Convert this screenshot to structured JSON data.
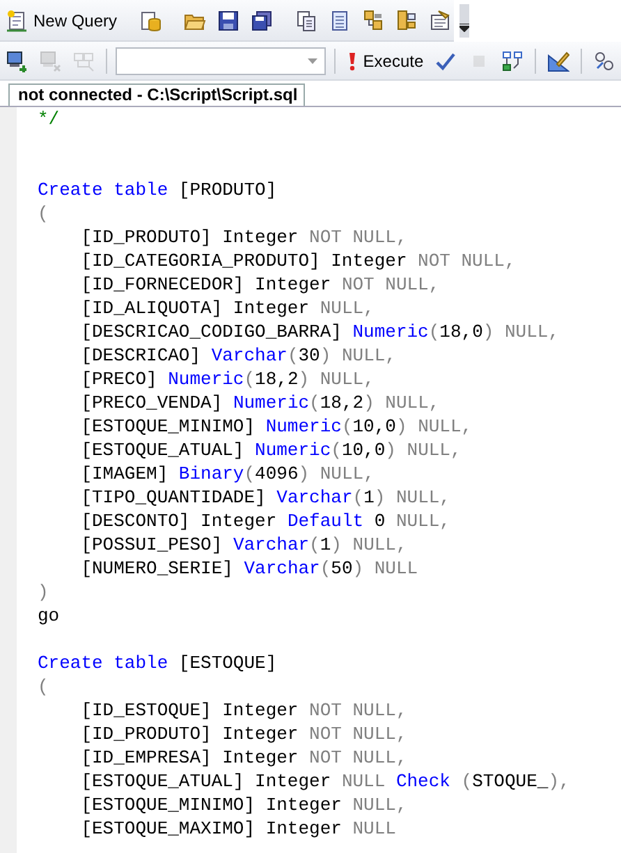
{
  "toolbars": [
    {
      "items": [
        {
          "kind": "button",
          "label": "New Query",
          "disabled": false
        },
        {
          "kind": "separator"
        },
        {
          "kind": "button",
          "disabled": false
        },
        {
          "kind": "separator"
        },
        {
          "kind": "button",
          "disabled": false
        },
        {
          "kind": "button",
          "disabled": false
        },
        {
          "kind": "button",
          "disabled": false
        },
        {
          "kind": "separator"
        },
        {
          "kind": "button",
          "disabled": false
        },
        {
          "kind": "button",
          "disabled": false
        },
        {
          "kind": "button",
          "disabled": false
        },
        {
          "kind": "button",
          "disabled": false
        },
        {
          "kind": "button",
          "disabled": false
        },
        {
          "kind": "overflow"
        }
      ]
    },
    {
      "items": [
        {
          "kind": "button",
          "disabled": false
        },
        {
          "kind": "button",
          "disabled": true
        },
        {
          "kind": "button",
          "disabled": true
        },
        {
          "kind": "separator"
        },
        {
          "kind": "dropdown"
        },
        {
          "kind": "separator"
        },
        {
          "kind": "button",
          "label": "Execute",
          "disabled": false
        },
        {
          "kind": "button",
          "disabled": false
        },
        {
          "kind": "button",
          "disabled": true
        },
        {
          "kind": "button",
          "disabled": false
        },
        {
          "kind": "separator"
        },
        {
          "kind": "button",
          "disabled": false
        },
        {
          "kind": "separator"
        },
        {
          "kind": "button",
          "disabled": false
        }
      ]
    }
  ],
  "tabs": [
    {
      "label": "not connected - C:\\Script\\Script.sql",
      "selected": true
    }
  ],
  "editor": {
    "comment_end": {
      "tokens": [
        {
          "kind": "comment",
          "text": "*/"
        }
      ]
    },
    "blocks": [
      {
        "lines": [
          {
            "tokens": [
              {
                "kind": "keyword",
                "text": "Create table"
              },
              {
                "kind": "plain",
                "text": " [PRODUTO]"
              }
            ]
          },
          {
            "tokens": [
              {
                "kind": "operator",
                "text": "("
              }
            ]
          },
          {
            "tokens": [
              {
                "kind": "plain",
                "text": "    [ID_PRODUTO] Integer "
              },
              {
                "kind": "operator",
                "text": "NOT NULL,"
              }
            ]
          },
          {
            "tokens": [
              {
                "kind": "plain",
                "text": "    [ID_CATEGORIA_PRODUTO] Integer "
              },
              {
                "kind": "operator",
                "text": "NOT NULL,"
              }
            ]
          },
          {
            "tokens": [
              {
                "kind": "plain",
                "text": "    [ID_FORNECEDOR] Integer "
              },
              {
                "kind": "operator",
                "text": "NOT NULL,"
              }
            ]
          },
          {
            "tokens": [
              {
                "kind": "plain",
                "text": "    [ID_ALIQUOTA] Integer "
              },
              {
                "kind": "operator",
                "text": "NULL,"
              }
            ]
          },
          {
            "tokens": [
              {
                "kind": "plain",
                "text": "    [DESCRICAO_CODIGO_BARRA] "
              },
              {
                "kind": "keyword",
                "text": "Numeric"
              },
              {
                "kind": "operator",
                "text": "("
              },
              {
                "kind": "plain",
                "text": "18,0"
              },
              {
                "kind": "operator",
                "text": ") NULL,"
              }
            ]
          },
          {
            "tokens": [
              {
                "kind": "plain",
                "text": "    [DESCRICAO] "
              },
              {
                "kind": "keyword",
                "text": "Varchar"
              },
              {
                "kind": "operator",
                "text": "("
              },
              {
                "kind": "plain",
                "text": "30"
              },
              {
                "kind": "operator",
                "text": ") NULL,"
              }
            ]
          },
          {
            "tokens": [
              {
                "kind": "plain",
                "text": "    [PRECO] "
              },
              {
                "kind": "keyword",
                "text": "Numeric"
              },
              {
                "kind": "operator",
                "text": "("
              },
              {
                "kind": "plain",
                "text": "18,2"
              },
              {
                "kind": "operator",
                "text": ") NULL,"
              }
            ]
          },
          {
            "tokens": [
              {
                "kind": "plain",
                "text": "    [PRECO_VENDA] "
              },
              {
                "kind": "keyword",
                "text": "Numeric"
              },
              {
                "kind": "operator",
                "text": "("
              },
              {
                "kind": "plain",
                "text": "18,2"
              },
              {
                "kind": "operator",
                "text": ") NULL,"
              }
            ]
          },
          {
            "tokens": [
              {
                "kind": "plain",
                "text": "    [ESTOQUE_MINIMO] "
              },
              {
                "kind": "keyword",
                "text": "Numeric"
              },
              {
                "kind": "operator",
                "text": "("
              },
              {
                "kind": "plain",
                "text": "10,0"
              },
              {
                "kind": "operator",
                "text": ") NULL,"
              }
            ]
          },
          {
            "tokens": [
              {
                "kind": "plain",
                "text": "    [ESTOQUE_ATUAL] "
              },
              {
                "kind": "keyword",
                "text": "Numeric"
              },
              {
                "kind": "operator",
                "text": "("
              },
              {
                "kind": "plain",
                "text": "10,0"
              },
              {
                "kind": "operator",
                "text": ") NULL,"
              }
            ]
          },
          {
            "tokens": [
              {
                "kind": "plain",
                "text": "    [IMAGEM] "
              },
              {
                "kind": "keyword",
                "text": "Binary"
              },
              {
                "kind": "operator",
                "text": "("
              },
              {
                "kind": "plain",
                "text": "4096"
              },
              {
                "kind": "operator",
                "text": ") NULL,"
              }
            ]
          },
          {
            "tokens": [
              {
                "kind": "plain",
                "text": "    [TIPO_QUANTIDADE] "
              },
              {
                "kind": "keyword",
                "text": "Varchar"
              },
              {
                "kind": "operator",
                "text": "("
              },
              {
                "kind": "plain",
                "text": "1"
              },
              {
                "kind": "operator",
                "text": ") NULL,"
              }
            ]
          },
          {
            "tokens": [
              {
                "kind": "plain",
                "text": "    [DESCONTO] Integer "
              },
              {
                "kind": "keyword",
                "text": "Default"
              },
              {
                "kind": "plain",
                "text": " 0 "
              },
              {
                "kind": "operator",
                "text": "NULL,"
              }
            ]
          },
          {
            "tokens": [
              {
                "kind": "plain",
                "text": "    [POSSUI_PESO] "
              },
              {
                "kind": "keyword",
                "text": "Varchar"
              },
              {
                "kind": "operator",
                "text": "("
              },
              {
                "kind": "plain",
                "text": "1"
              },
              {
                "kind": "operator",
                "text": ") NULL,"
              }
            ]
          },
          {
            "tokens": [
              {
                "kind": "plain",
                "text": "    [NUMERO_SERIE] "
              },
              {
                "kind": "keyword",
                "text": "Varchar"
              },
              {
                "kind": "operator",
                "text": "("
              },
              {
                "kind": "plain",
                "text": "50"
              },
              {
                "kind": "operator",
                "text": ") NULL"
              }
            ]
          },
          {
            "tokens": [
              {
                "kind": "operator",
                "text": ")"
              }
            ]
          },
          {
            "tokens": [
              {
                "kind": "plain",
                "text": "go"
              }
            ]
          }
        ]
      },
      {
        "lines": [
          {
            "tokens": [
              {
                "kind": "keyword",
                "text": "Create table"
              },
              {
                "kind": "plain",
                "text": " [ESTOQUE]"
              }
            ]
          },
          {
            "tokens": [
              {
                "kind": "operator",
                "text": "("
              }
            ]
          },
          {
            "tokens": [
              {
                "kind": "plain",
                "text": "    [ID_ESTOQUE] Integer "
              },
              {
                "kind": "operator",
                "text": "NOT NULL,"
              }
            ]
          },
          {
            "tokens": [
              {
                "kind": "plain",
                "text": "    [ID_PRODUTO] Integer "
              },
              {
                "kind": "operator",
                "text": "NOT NULL,"
              }
            ]
          },
          {
            "tokens": [
              {
                "kind": "plain",
                "text": "    [ID_EMPRESA] Integer "
              },
              {
                "kind": "operator",
                "text": "NOT NULL,"
              }
            ]
          },
          {
            "tokens": [
              {
                "kind": "plain",
                "text": "    [ESTOQUE_ATUAL] Integer "
              },
              {
                "kind": "operator",
                "text": "NULL "
              },
              {
                "kind": "keyword",
                "text": "Check"
              },
              {
                "kind": "operator",
                "text": " ("
              },
              {
                "kind": "plain",
                "text": "STOQUE_"
              },
              {
                "kind": "operator",
                "text": "),"
              }
            ]
          },
          {
            "tokens": [
              {
                "kind": "plain",
                "text": "    [ESTOQUE_MINIMO] Integer "
              },
              {
                "kind": "operator",
                "text": "NULL,"
              }
            ]
          },
          {
            "tokens": [
              {
                "kind": "plain",
                "text": "    [ESTOQUE_MAXIMO] Integer "
              },
              {
                "kind": "operator",
                "text": "NULL"
              }
            ]
          }
        ]
      }
    ]
  }
}
